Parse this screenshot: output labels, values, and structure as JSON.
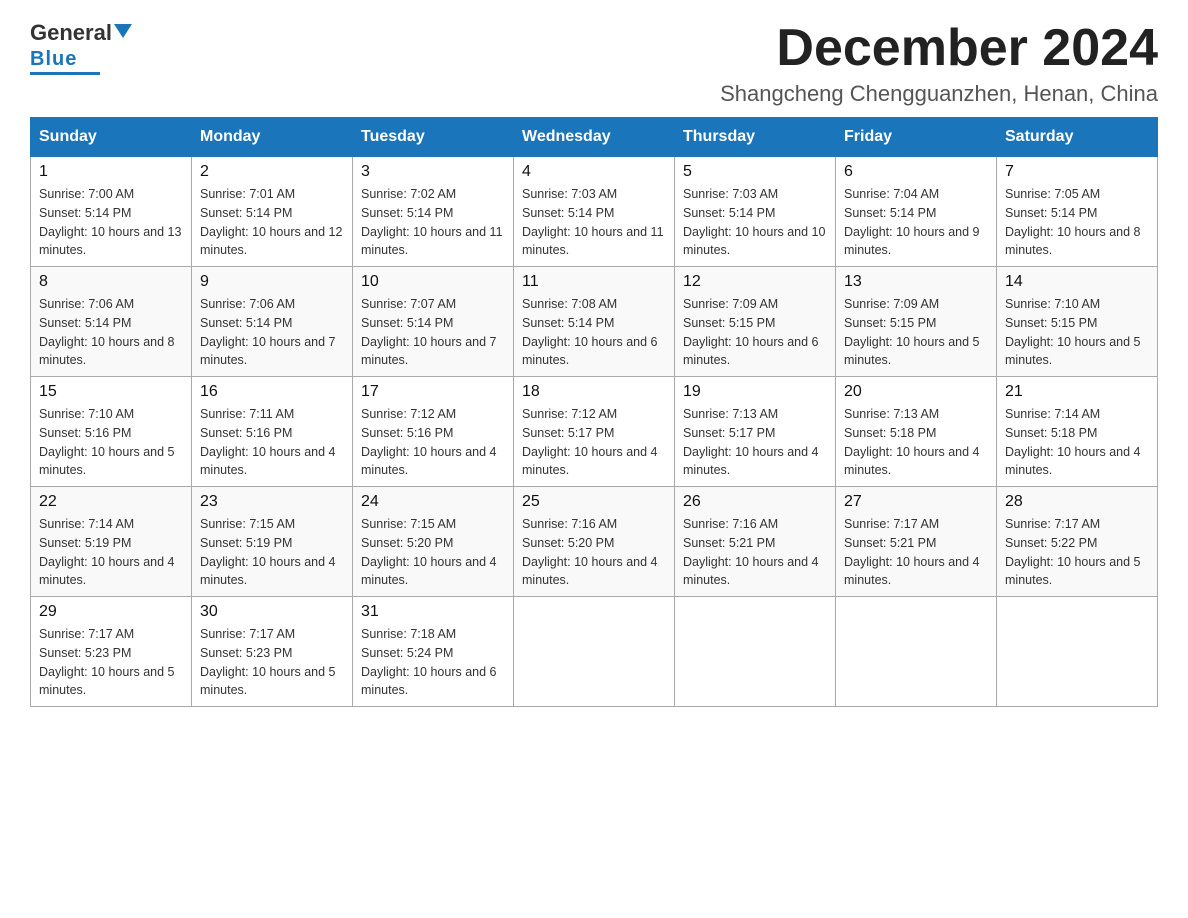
{
  "header": {
    "logo_general": "General",
    "logo_blue": "Blue",
    "month_title": "December 2024",
    "location": "Shangcheng Chengguanzhen, Henan, China"
  },
  "days_of_week": [
    "Sunday",
    "Monday",
    "Tuesday",
    "Wednesday",
    "Thursday",
    "Friday",
    "Saturday"
  ],
  "weeks": [
    [
      {
        "day": "1",
        "sunrise": "7:00 AM",
        "sunset": "5:14 PM",
        "daylight": "10 hours and 13 minutes."
      },
      {
        "day": "2",
        "sunrise": "7:01 AM",
        "sunset": "5:14 PM",
        "daylight": "10 hours and 12 minutes."
      },
      {
        "day": "3",
        "sunrise": "7:02 AM",
        "sunset": "5:14 PM",
        "daylight": "10 hours and 11 minutes."
      },
      {
        "day": "4",
        "sunrise": "7:03 AM",
        "sunset": "5:14 PM",
        "daylight": "10 hours and 11 minutes."
      },
      {
        "day": "5",
        "sunrise": "7:03 AM",
        "sunset": "5:14 PM",
        "daylight": "10 hours and 10 minutes."
      },
      {
        "day": "6",
        "sunrise": "7:04 AM",
        "sunset": "5:14 PM",
        "daylight": "10 hours and 9 minutes."
      },
      {
        "day": "7",
        "sunrise": "7:05 AM",
        "sunset": "5:14 PM",
        "daylight": "10 hours and 8 minutes."
      }
    ],
    [
      {
        "day": "8",
        "sunrise": "7:06 AM",
        "sunset": "5:14 PM",
        "daylight": "10 hours and 8 minutes."
      },
      {
        "day": "9",
        "sunrise": "7:06 AM",
        "sunset": "5:14 PM",
        "daylight": "10 hours and 7 minutes."
      },
      {
        "day": "10",
        "sunrise": "7:07 AM",
        "sunset": "5:14 PM",
        "daylight": "10 hours and 7 minutes."
      },
      {
        "day": "11",
        "sunrise": "7:08 AM",
        "sunset": "5:14 PM",
        "daylight": "10 hours and 6 minutes."
      },
      {
        "day": "12",
        "sunrise": "7:09 AM",
        "sunset": "5:15 PM",
        "daylight": "10 hours and 6 minutes."
      },
      {
        "day": "13",
        "sunrise": "7:09 AM",
        "sunset": "5:15 PM",
        "daylight": "10 hours and 5 minutes."
      },
      {
        "day": "14",
        "sunrise": "7:10 AM",
        "sunset": "5:15 PM",
        "daylight": "10 hours and 5 minutes."
      }
    ],
    [
      {
        "day": "15",
        "sunrise": "7:10 AM",
        "sunset": "5:16 PM",
        "daylight": "10 hours and 5 minutes."
      },
      {
        "day": "16",
        "sunrise": "7:11 AM",
        "sunset": "5:16 PM",
        "daylight": "10 hours and 4 minutes."
      },
      {
        "day": "17",
        "sunrise": "7:12 AM",
        "sunset": "5:16 PM",
        "daylight": "10 hours and 4 minutes."
      },
      {
        "day": "18",
        "sunrise": "7:12 AM",
        "sunset": "5:17 PM",
        "daylight": "10 hours and 4 minutes."
      },
      {
        "day": "19",
        "sunrise": "7:13 AM",
        "sunset": "5:17 PM",
        "daylight": "10 hours and 4 minutes."
      },
      {
        "day": "20",
        "sunrise": "7:13 AM",
        "sunset": "5:18 PM",
        "daylight": "10 hours and 4 minutes."
      },
      {
        "day": "21",
        "sunrise": "7:14 AM",
        "sunset": "5:18 PM",
        "daylight": "10 hours and 4 minutes."
      }
    ],
    [
      {
        "day": "22",
        "sunrise": "7:14 AM",
        "sunset": "5:19 PM",
        "daylight": "10 hours and 4 minutes."
      },
      {
        "day": "23",
        "sunrise": "7:15 AM",
        "sunset": "5:19 PM",
        "daylight": "10 hours and 4 minutes."
      },
      {
        "day": "24",
        "sunrise": "7:15 AM",
        "sunset": "5:20 PM",
        "daylight": "10 hours and 4 minutes."
      },
      {
        "day": "25",
        "sunrise": "7:16 AM",
        "sunset": "5:20 PM",
        "daylight": "10 hours and 4 minutes."
      },
      {
        "day": "26",
        "sunrise": "7:16 AM",
        "sunset": "5:21 PM",
        "daylight": "10 hours and 4 minutes."
      },
      {
        "day": "27",
        "sunrise": "7:17 AM",
        "sunset": "5:21 PM",
        "daylight": "10 hours and 4 minutes."
      },
      {
        "day": "28",
        "sunrise": "7:17 AM",
        "sunset": "5:22 PM",
        "daylight": "10 hours and 5 minutes."
      }
    ],
    [
      {
        "day": "29",
        "sunrise": "7:17 AM",
        "sunset": "5:23 PM",
        "daylight": "10 hours and 5 minutes."
      },
      {
        "day": "30",
        "sunrise": "7:17 AM",
        "sunset": "5:23 PM",
        "daylight": "10 hours and 5 minutes."
      },
      {
        "day": "31",
        "sunrise": "7:18 AM",
        "sunset": "5:24 PM",
        "daylight": "10 hours and 6 minutes."
      },
      null,
      null,
      null,
      null
    ]
  ]
}
